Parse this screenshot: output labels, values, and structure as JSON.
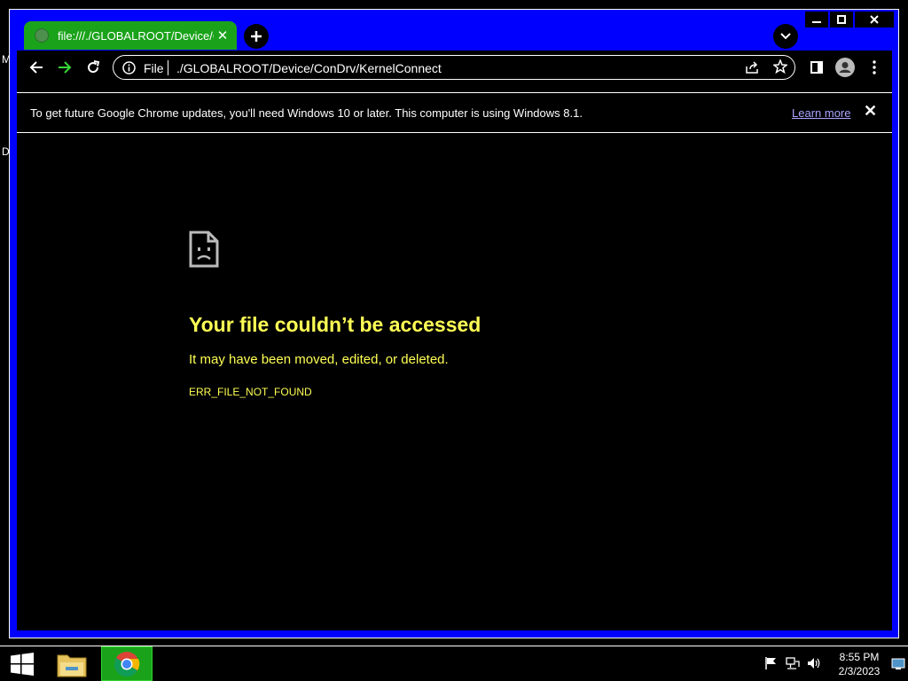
{
  "desktop": {
    "label_m": "M",
    "label_d": "D"
  },
  "window_controls": {
    "minimize": "—",
    "maximize": "□",
    "close": "✕"
  },
  "tab": {
    "title": "file:///./GLOBALROOT/Device/ConDrv/KernelConnect",
    "close": "✕"
  },
  "toolbar": {
    "scheme_label": "File",
    "url": "./GLOBALROOT/Device/ConDrv/KernelConnect"
  },
  "infobar": {
    "message": "To get future Google Chrome updates, you'll need Windows 10 or later. This computer is using Windows 8.1.",
    "learn_more": "Learn more",
    "close": "✕"
  },
  "error": {
    "title": "Your file couldn’t be accessed",
    "subtitle": "It may have been moved, edited, or deleted.",
    "code": "ERR_FILE_NOT_FOUND"
  },
  "taskbar": {
    "time": "8:55 PM",
    "date": "2/3/2023"
  },
  "colors": {
    "window_frame": "#0000ff",
    "tab_active": "#1aa31a",
    "error_text": "#ffff55",
    "link": "#a8a4ff"
  }
}
